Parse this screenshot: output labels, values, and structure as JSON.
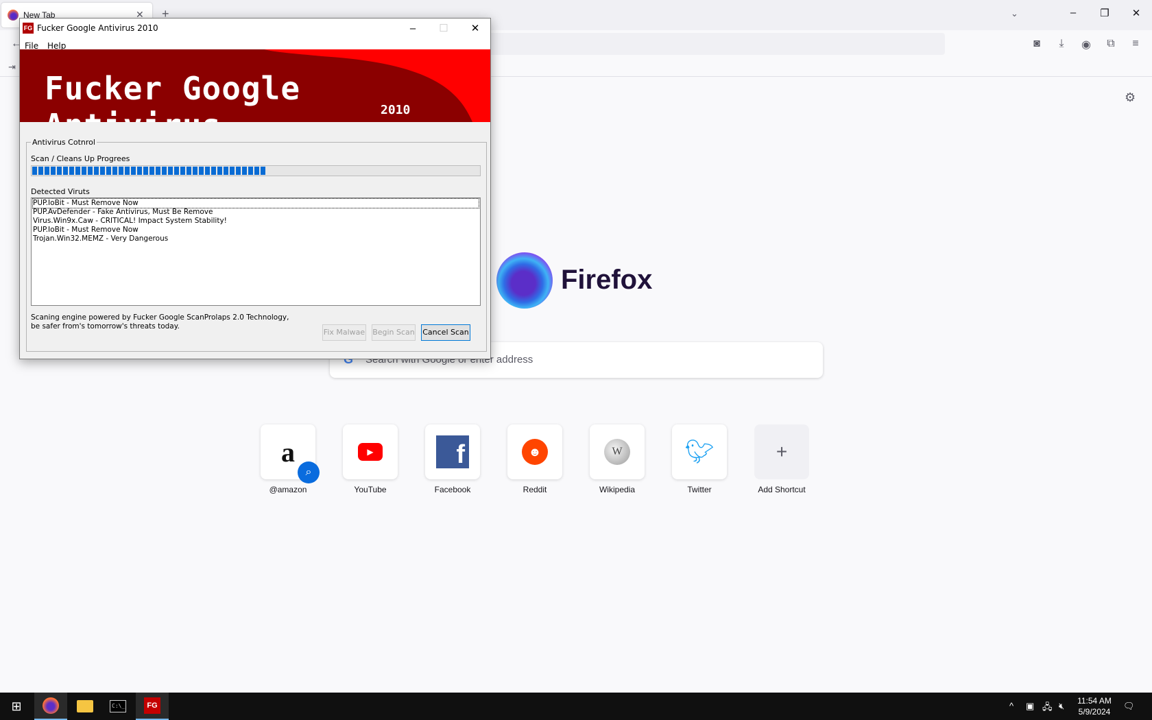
{
  "browser": {
    "tab_title": "New Tab",
    "search_placeholder": "Search with Google or enter address",
    "wordmark": "Firefox",
    "shortcuts": [
      {
        "label": "@amazon",
        "icon": "amazon-icon"
      },
      {
        "label": "YouTube",
        "icon": "youtube-icon"
      },
      {
        "label": "Facebook",
        "icon": "facebook-icon"
      },
      {
        "label": "Reddit",
        "icon": "reddit-icon"
      },
      {
        "label": "Wikipedia",
        "icon": "wikipedia-icon"
      },
      {
        "label": "Twitter",
        "icon": "twitter-icon"
      },
      {
        "label": "Add Shortcut",
        "icon": "plus-icon"
      }
    ]
  },
  "av_window": {
    "title": "Fucker Google Antivirus 2010",
    "app_icon_text": "FG",
    "menu": [
      "File",
      "Help"
    ],
    "banner_title": "Fucker Google Antivirus",
    "banner_year": "2010",
    "group_label": "Antivirus Cotnrol",
    "progress_label": "Scan / Cleans Up Progrees",
    "progress_percent": 52,
    "detected_label": "Detected Viruts",
    "detected": [
      "PUP.IoBit - Must Remove Now",
      "PUP.AvDefender - Fake Antivirus, Must Be Remove",
      "Virus.Win9x.Caw - CRITICAL! Impact System Stability!",
      "PUP.IoBit - Must Remove Now",
      "Trojan.Win32.MEMZ - Very Dangerous"
    ],
    "footer_text": "Scaning engine powered by Fucker Google ScanProlaps 2.0 Technology, be safer from's tomorrow's threats today.",
    "buttons": {
      "fix": "Fix Malwae",
      "begin": "Begin Scan",
      "cancel": "Cancel Scan"
    }
  },
  "taskbar": {
    "time": "11:54 AM",
    "date": "5/9/2024",
    "fg_label": "FG"
  },
  "colors": {
    "banner_dark": "#8b0000",
    "banner_bright": "#ff0000",
    "progress": "#0a6cd4"
  }
}
